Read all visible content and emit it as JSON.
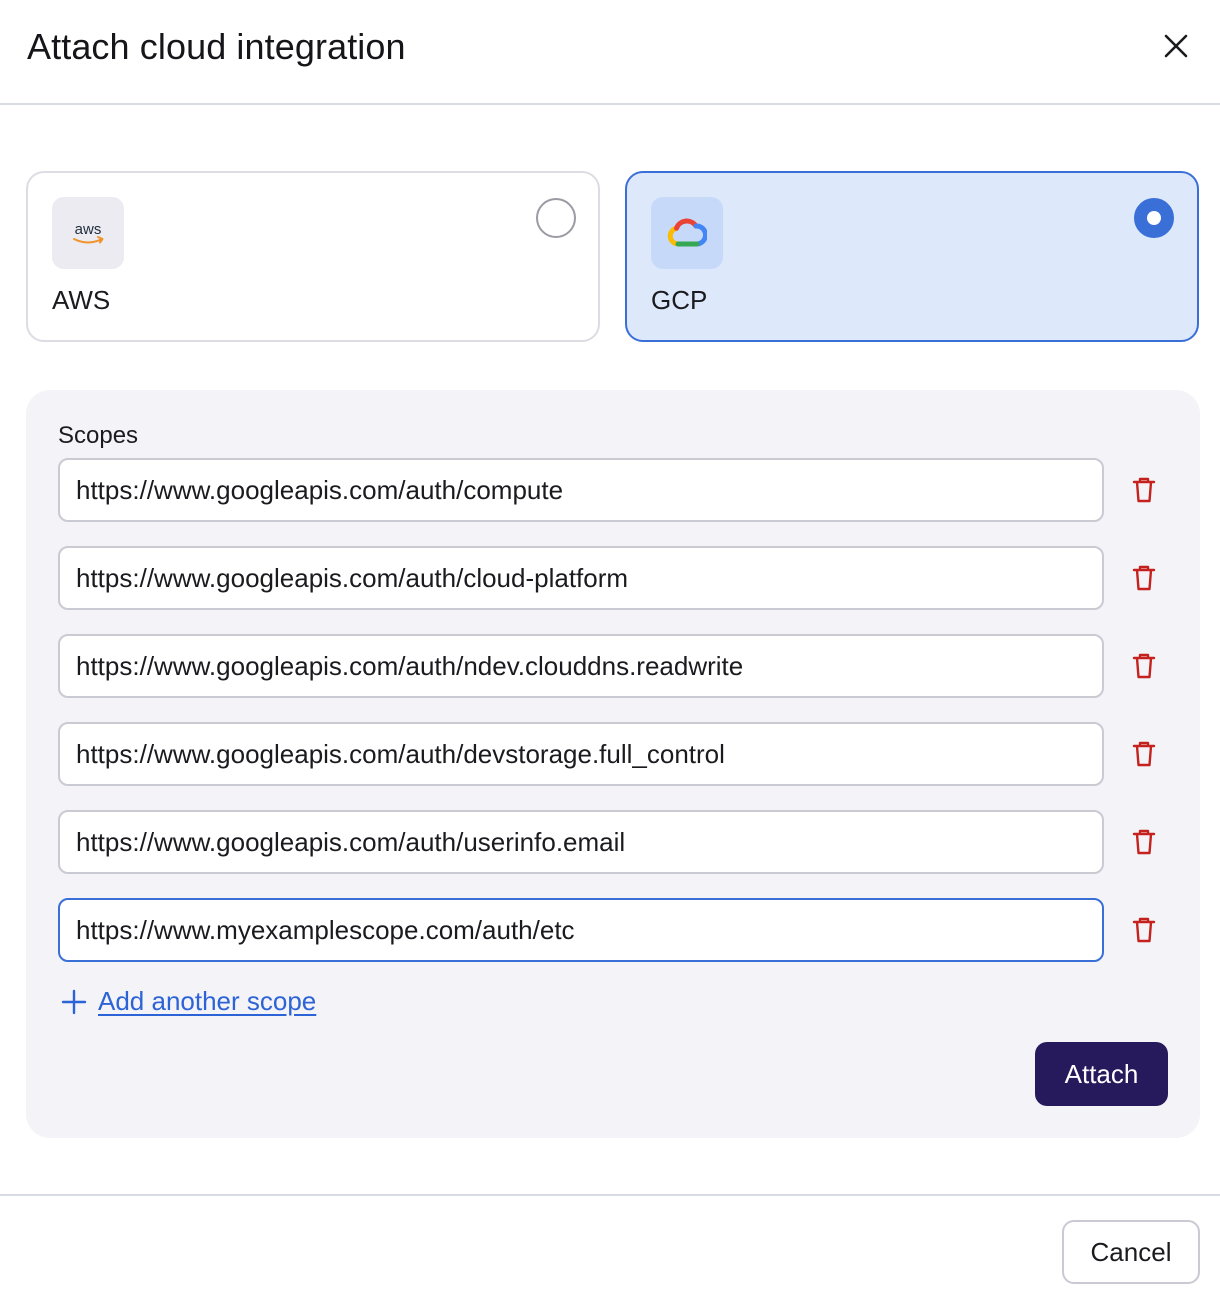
{
  "dialog": {
    "title": "Attach cloud integration",
    "close_icon": "close-icon"
  },
  "providers": [
    {
      "id": "aws",
      "label": "AWS",
      "logo_text": "aws",
      "icon": "aws-logo-icon",
      "selected": false
    },
    {
      "id": "gcp",
      "label": "GCP",
      "icon": "google-cloud-logo-icon",
      "selected": true
    }
  ],
  "scopes": {
    "label": "Scopes",
    "items": [
      "https://www.googleapis.com/auth/compute",
      "https://www.googleapis.com/auth/cloud-platform",
      "https://www.googleapis.com/auth/ndev.clouddns.readwrite",
      "https://www.googleapis.com/auth/devstorage.full_control",
      "https://www.googleapis.com/auth/userinfo.email",
      "https://www.myexamplescope.com/auth/etc"
    ],
    "delete_icon": "trash-icon",
    "add_label": "Add another scope",
    "add_icon": "plus-icon",
    "attach_label": "Attach"
  },
  "footer": {
    "cancel_label": "Cancel"
  },
  "colors": {
    "accent": "#3a6fd8",
    "selected_card_bg": "#dde8fb",
    "primary_button": "#271a5c",
    "delete": "#c5221f",
    "link": "#2c63d6"
  }
}
